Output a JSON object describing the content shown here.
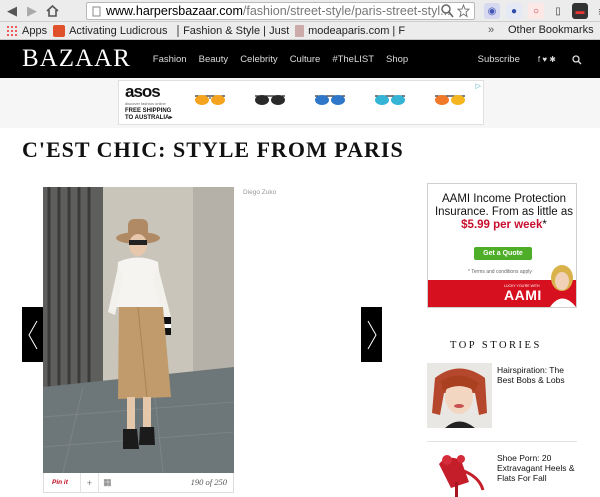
{
  "browser": {
    "url_host": "www.harpersbazaar.com",
    "url_path": "/fashion/street-style/paris-street-styl...",
    "bookmarks": [
      {
        "label": "Apps"
      },
      {
        "label": "Activating Ludicrous"
      },
      {
        "label": "Fashion & Style | Just"
      },
      {
        "label": "modeaparis.com | F"
      }
    ],
    "other_bookmarks": "Other Bookmarks",
    "more": "»"
  },
  "site": {
    "logo": "BAZAAR",
    "nav": [
      "Fashion",
      "Beauty",
      "Celebrity",
      "Culture",
      "#TheLIST",
      "Shop"
    ],
    "subscribe": "Subscribe",
    "social": "f ♥ ✱"
  },
  "ad_top": {
    "brand": "asos",
    "tagline": "discover fashion online",
    "shipping": "FREE SHIPPING TO AUSTRALIA▸"
  },
  "article": {
    "title": "C'EST CHIC: STYLE FROM PARIS",
    "credit": "Diego Zuko",
    "pinit": "Pin it",
    "counter": "190 of 250"
  },
  "ad_right": {
    "headline_1": "AAMI Income Protection Insurance. From as little as ",
    "price": "$5.99 per week",
    "asterisk": "*",
    "button": "Get a Quote",
    "terms": "* Terms and conditions apply",
    "tag": "LUCKY YOU'RE WITH",
    "logo": "AAMI"
  },
  "top_stories": {
    "heading": "TOP STORIES",
    "items": [
      {
        "title": "Hairspiration: The Best Bobs & Lobs"
      },
      {
        "title": "Shoe Porn: 20 Extravagant Heels & Flats For Fall"
      }
    ]
  },
  "colors": {
    "nav_bg": "#000000",
    "aami_red": "#d7101f",
    "quote_green": "#4fae28"
  }
}
